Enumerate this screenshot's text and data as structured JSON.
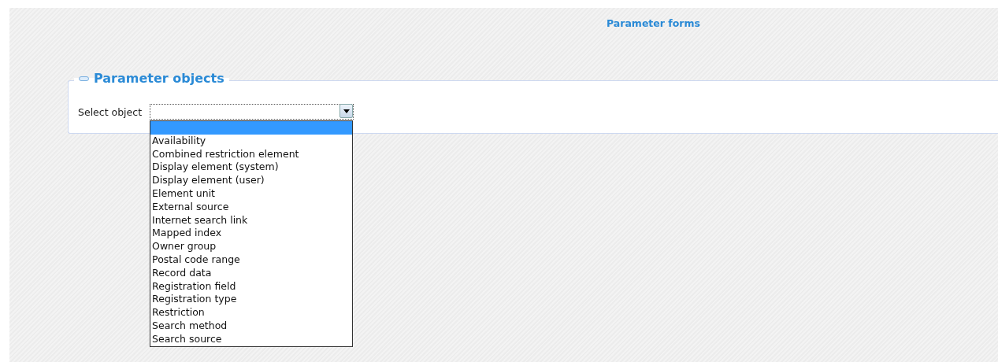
{
  "page_title": "Parameter forms",
  "panel": {
    "title": "Parameter objects",
    "expanded": true,
    "field": {
      "label": "Select object",
      "open": true,
      "options": [
        {
          "selected": true
        },
        {
          "label": "Availability",
          "selected": false
        },
        {
          "label": "Combined restriction element",
          "selected": false
        },
        {
          "label": "Display element (system)",
          "selected": false
        },
        {
          "label": "Display element (user)",
          "selected": false
        },
        {
          "label": "Element unit",
          "selected": false
        },
        {
          "label": "External source",
          "selected": false
        },
        {
          "label": "Internet search link",
          "selected": false
        },
        {
          "label": "Mapped index",
          "selected": false
        },
        {
          "label": "Owner group",
          "selected": false
        },
        {
          "label": "Postal code range",
          "selected": false
        },
        {
          "label": "Record data",
          "selected": false
        },
        {
          "label": "Registration field",
          "selected": false
        },
        {
          "label": "Registration type",
          "selected": false
        },
        {
          "label": "Restriction",
          "selected": false
        },
        {
          "label": "Search method",
          "selected": false
        },
        {
          "label": "Search source",
          "selected": false
        }
      ]
    }
  }
}
